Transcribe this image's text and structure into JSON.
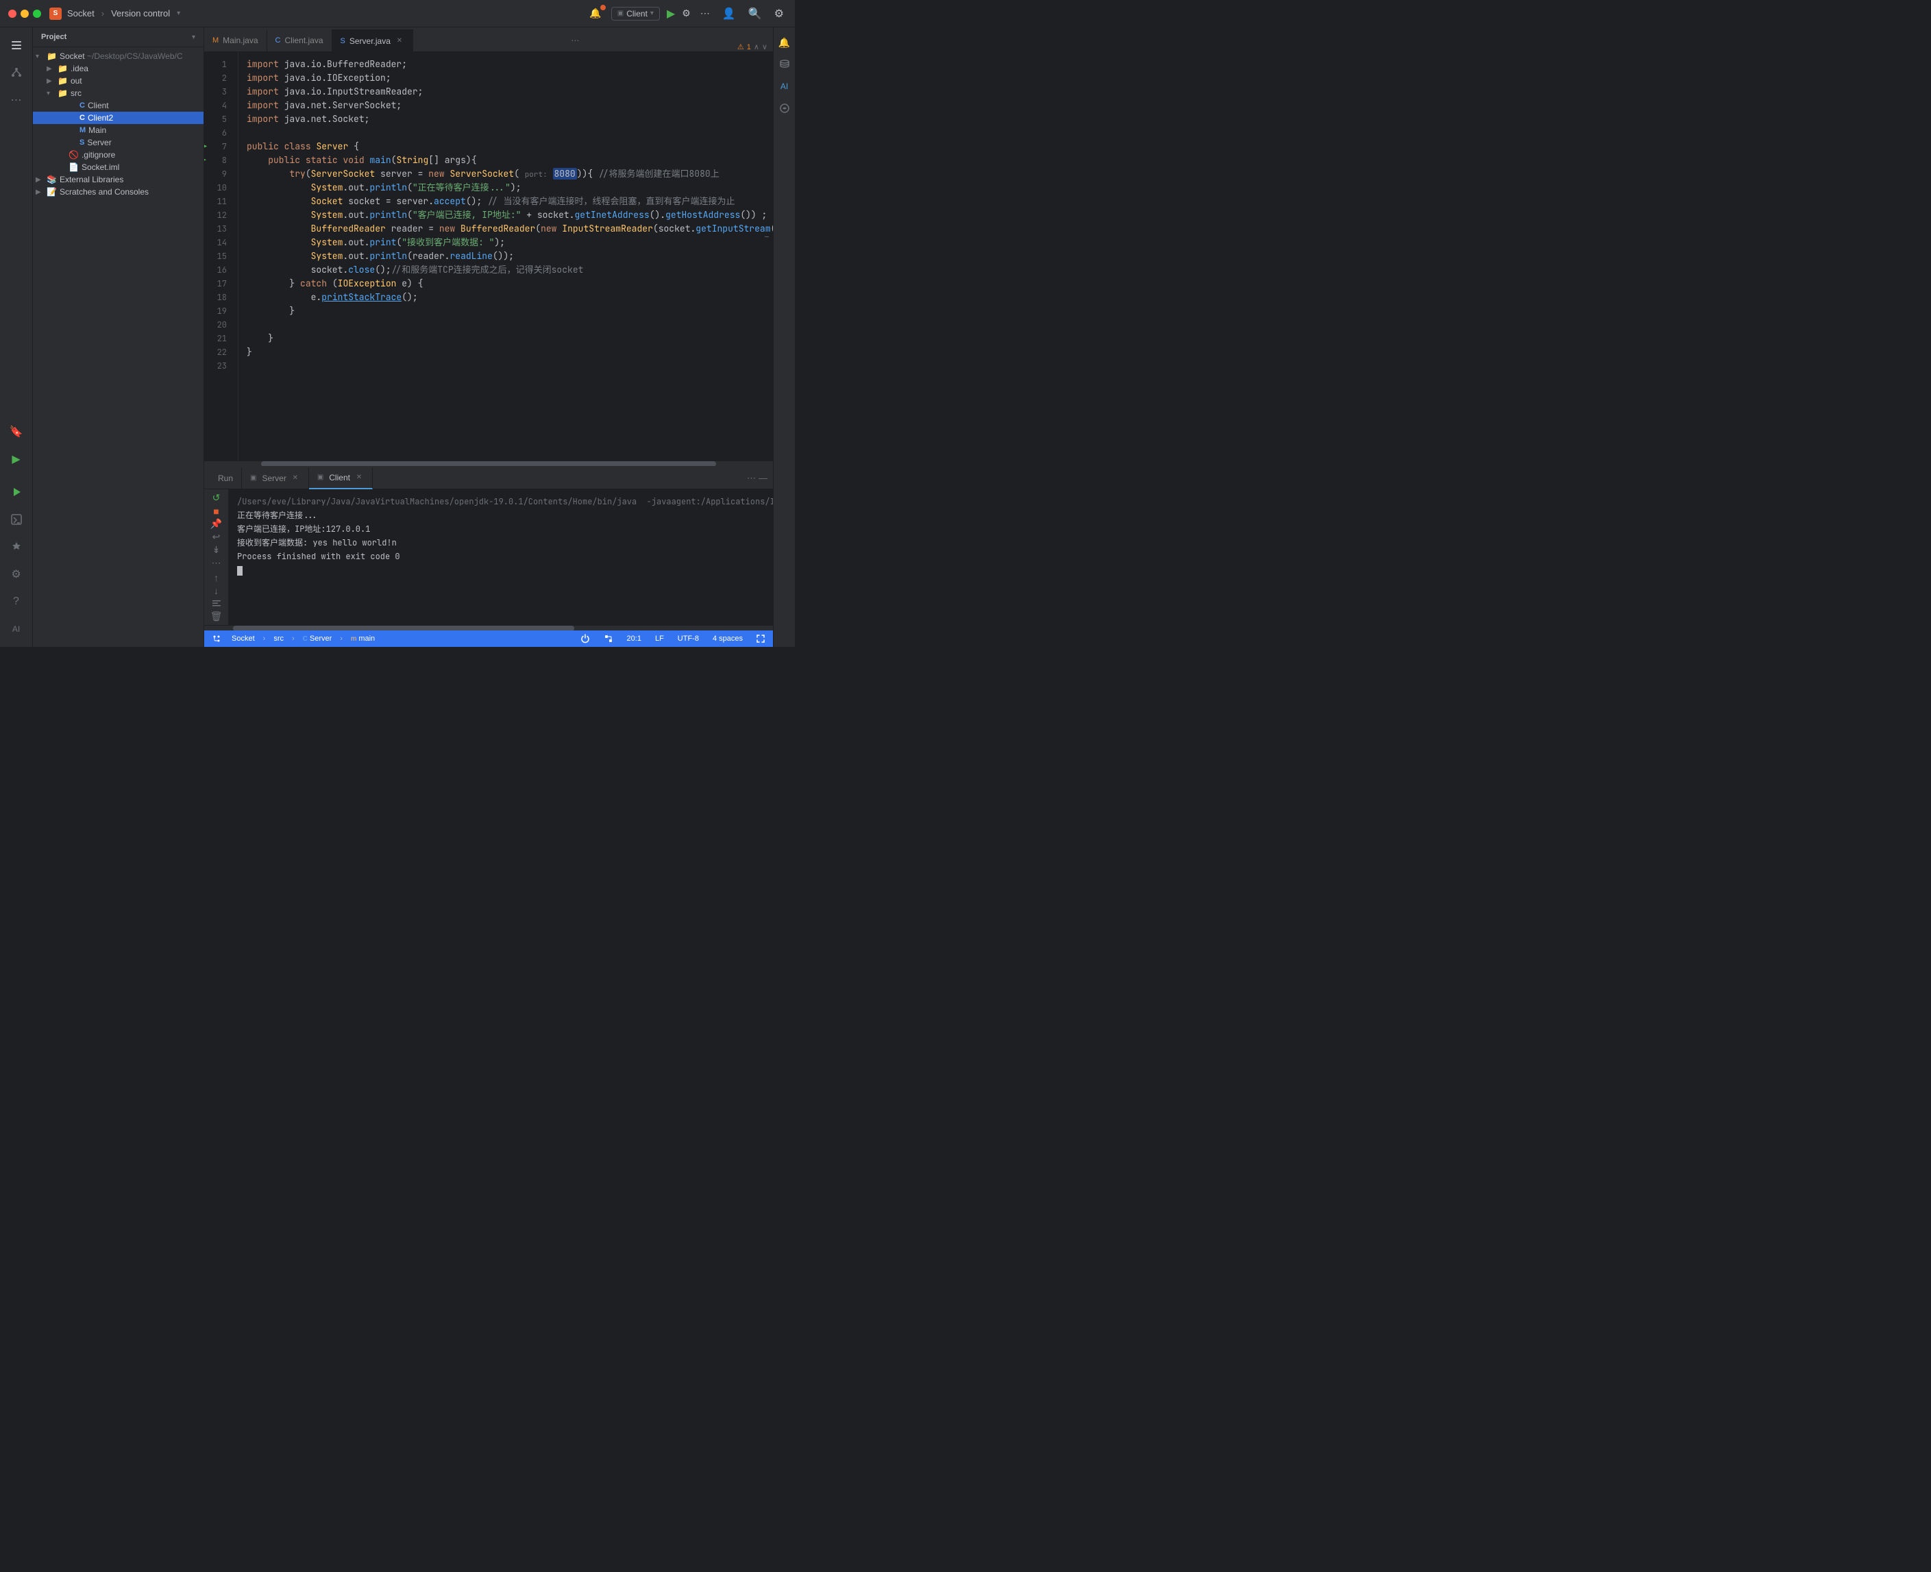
{
  "titlebar": {
    "project_name": "Socket",
    "project_path": "~/Desktop/CS/JavaWeb/C",
    "vcs_label": "Version control",
    "run_config": "Client",
    "run_btn": "▶",
    "debug_btn": "🐛"
  },
  "sidebar": {
    "title": "Project",
    "tree": [
      {
        "id": "root",
        "label": "Socket ~/Desktop/CS/JavaWeb/C",
        "indent": 0,
        "arrow": "▾",
        "icon": "📁",
        "type": "root"
      },
      {
        "id": "idea",
        "label": ".idea",
        "indent": 1,
        "arrow": "▶",
        "icon": "📁",
        "type": "folder"
      },
      {
        "id": "out",
        "label": "out",
        "indent": 1,
        "arrow": "▶",
        "icon": "📁",
        "type": "folder"
      },
      {
        "id": "src",
        "label": "src",
        "indent": 1,
        "arrow": "▾",
        "icon": "📁",
        "type": "folder"
      },
      {
        "id": "client",
        "label": "Client",
        "indent": 2,
        "arrow": "",
        "icon": "🔵",
        "type": "file"
      },
      {
        "id": "client2",
        "label": "Client2",
        "indent": 2,
        "arrow": "",
        "icon": "🔵",
        "type": "file",
        "selected": true
      },
      {
        "id": "main",
        "label": "Main",
        "indent": 2,
        "arrow": "",
        "icon": "🔵",
        "type": "file"
      },
      {
        "id": "server",
        "label": "Server",
        "indent": 2,
        "arrow": "",
        "icon": "🔵",
        "type": "file"
      },
      {
        "id": "gitignore",
        "label": ".gitignore",
        "indent": 1,
        "arrow": "",
        "icon": "🚫",
        "type": "file"
      },
      {
        "id": "socketiml",
        "label": "Socket.iml",
        "indent": 1,
        "arrow": "",
        "icon": "📄",
        "type": "file"
      },
      {
        "id": "extlibs",
        "label": "External Libraries",
        "indent": 0,
        "arrow": "▶",
        "icon": "📚",
        "type": "folder"
      },
      {
        "id": "scratches",
        "label": "Scratches and Consoles",
        "indent": 0,
        "arrow": "▶",
        "icon": "📝",
        "type": "folder"
      }
    ]
  },
  "tabs": [
    {
      "id": "main",
      "label": "Main.java",
      "icon": "M",
      "active": false,
      "modified": false
    },
    {
      "id": "client",
      "label": "Client.java",
      "icon": "C",
      "active": false,
      "modified": false
    },
    {
      "id": "server",
      "label": "Server.java",
      "icon": "S",
      "active": true,
      "modified": false
    }
  ],
  "code": {
    "lines": [
      {
        "num": 1,
        "text": "import java.io.BufferedReader;",
        "has_run": false
      },
      {
        "num": 2,
        "text": "import java.io.IOException;",
        "has_run": false
      },
      {
        "num": 3,
        "text": "import java.io.InputStreamReader;",
        "has_run": false
      },
      {
        "num": 4,
        "text": "import java.net.ServerSocket;",
        "has_run": false
      },
      {
        "num": 5,
        "text": "import java.net.Socket;",
        "has_run": false
      },
      {
        "num": 6,
        "text": "",
        "has_run": false
      },
      {
        "num": 7,
        "text": "public class Server {",
        "has_run": false,
        "has_run_arrow": true
      },
      {
        "num": 8,
        "text": "    public static void main(String[] args){",
        "has_run": false,
        "has_run_marker": true
      },
      {
        "num": 9,
        "text": "        try(ServerSocket server = new ServerSocket( port: 8080)){ //将服务端创建在端口8080上",
        "has_run": false
      },
      {
        "num": 10,
        "text": "            System.out.println(\"正在等待客户连接...\");",
        "has_run": false
      },
      {
        "num": 11,
        "text": "            Socket socket = server.accept(); // 当没有客户端连接时，线程会阻塞，直到有客户端连接为止",
        "has_run": false
      },
      {
        "num": 12,
        "text": "            System.out.println(\"客户端已连接, IP地址:\" + socket.getInetAddress().getHostAddress()) ;",
        "has_run": false
      },
      {
        "num": 13,
        "text": "            BufferedReader reader = new BufferedReader(new InputStreamReader(socket.getInputStream())); // 通过",
        "has_run": false
      },
      {
        "num": 14,
        "text": "            System.out.print(\"接收到客户端数据: \");",
        "has_run": false
      },
      {
        "num": 15,
        "text": "            System.out.println(reader.readLine());",
        "has_run": false
      },
      {
        "num": 16,
        "text": "            socket.close();//和服务端TCP连接完成之后，记得关闭socket",
        "has_run": false
      },
      {
        "num": 17,
        "text": "        } catch (IOException e) {",
        "has_run": false
      },
      {
        "num": 18,
        "text": "            e.printStackTrace();",
        "has_run": false
      },
      {
        "num": 19,
        "text": "        }",
        "has_run": false
      },
      {
        "num": 20,
        "text": "",
        "has_run": false
      },
      {
        "num": 21,
        "text": "    }",
        "has_run": false
      },
      {
        "num": 22,
        "text": "}",
        "has_run": false
      },
      {
        "num": 23,
        "text": "",
        "has_run": false
      }
    ]
  },
  "run_panel": {
    "title": "Run",
    "tabs": [
      {
        "id": "server",
        "label": "Server",
        "active": false
      },
      {
        "id": "client",
        "label": "Client",
        "active": true
      }
    ],
    "output": [
      "/Users/eve/Library/Java/JavaVirtualMachines/openjdk-19.0.1/Contents/Home/bin/java  -javaagent:/Applications/IntelliJ IDEA.app/Contents/lib/idea_rt.ja",
      "正在等待客户连接...",
      "客户端已连接，IP地址:127.0.0.1",
      "接收到客户端数据: yes hello world!n",
      "",
      "Process finished with exit code 0"
    ]
  },
  "statusbar": {
    "left": [
      {
        "id": "git",
        "label": "Socket"
      },
      {
        "id": "sep1",
        "label": ">"
      },
      {
        "id": "src",
        "label": "src"
      },
      {
        "id": "sep2",
        "label": ">"
      },
      {
        "id": "server_cls",
        "label": "Server"
      },
      {
        "id": "sep3",
        "label": ">"
      },
      {
        "id": "main_fn",
        "label": "main"
      }
    ],
    "right": [
      {
        "id": "power",
        "label": "⚡"
      },
      {
        "id": "vcs",
        "label": ""
      },
      {
        "id": "cursor",
        "label": "20:1"
      },
      {
        "id": "lf",
        "label": "LF"
      },
      {
        "id": "encoding",
        "label": "UTF-8"
      },
      {
        "id": "indent",
        "label": "4 spaces"
      },
      {
        "id": "expand",
        "label": "⤢"
      }
    ]
  }
}
